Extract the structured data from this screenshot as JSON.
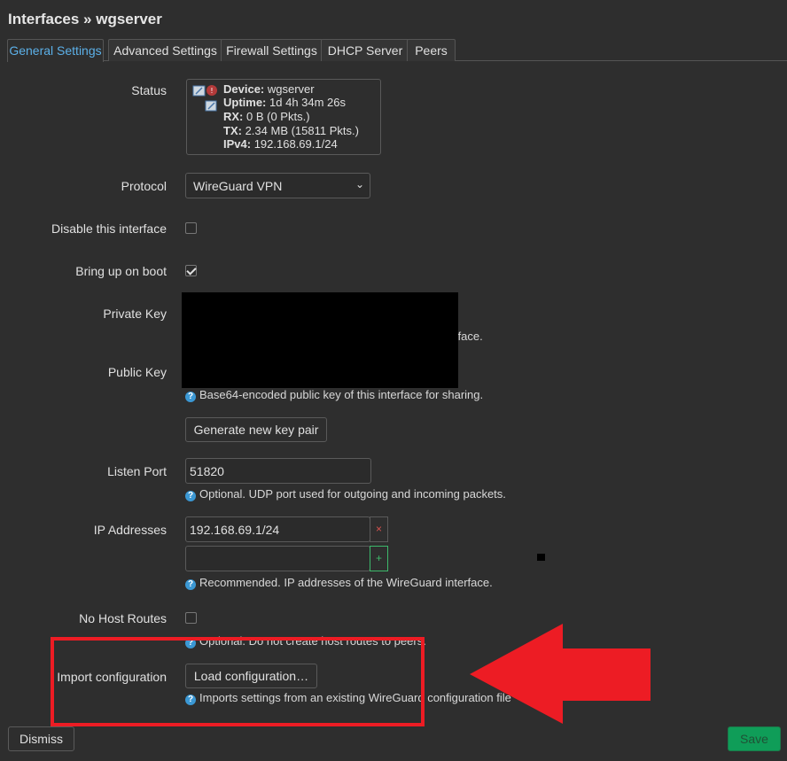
{
  "page_title": "Interfaces » wgserver",
  "tabs": [
    {
      "label": "General Settings"
    },
    {
      "label": "Advanced Settings"
    },
    {
      "label": "Firewall Settings"
    },
    {
      "label": "DHCP Server"
    },
    {
      "label": "Peers"
    }
  ],
  "status": {
    "label": "Status",
    "device_key": "Device:",
    "device_val": "wgserver",
    "uptime_key": "Uptime:",
    "uptime_val": "1d 4h 34m 26s",
    "rx_key": "RX:",
    "rx_val": "0 B (0 Pkts.)",
    "tx_key": "TX:",
    "tx_val": "2.34 MB (15811 Pkts.)",
    "ipv4_key": "IPv4:",
    "ipv4_val": "192.168.69.1/24"
  },
  "protocol": {
    "label": "Protocol",
    "value": "WireGuard VPN"
  },
  "disable_interface": {
    "label": "Disable this interface",
    "checked": false
  },
  "bring_up_on_boot": {
    "label": "Bring up on boot",
    "checked": true
  },
  "private_key": {
    "label": "Private Key",
    "hint_fragment": "erface."
  },
  "public_key": {
    "label": "Public Key",
    "hint": "Base64-encoded public key of this interface for sharing."
  },
  "generate_key_button": "Generate new key pair",
  "listen_port": {
    "label": "Listen Port",
    "value": "51820",
    "hint": "Optional. UDP port used for outgoing and incoming packets."
  },
  "ip_addresses": {
    "label": "IP Addresses",
    "values": [
      "192.168.69.1/24",
      ""
    ],
    "remove_glyph": "×",
    "add_glyph": "+",
    "hint": "Recommended. IP addresses of the WireGuard interface."
  },
  "no_host_routes": {
    "label": "No Host Routes",
    "checked": false,
    "hint": "Optional. Do not create host routes to peers."
  },
  "import_configuration": {
    "label": "Import configuration",
    "button": "Load configuration…",
    "hint": "Imports settings from an existing WireGuard configuration file"
  },
  "footer": {
    "dismiss": "Dismiss",
    "save": "Save"
  },
  "colors": {
    "accent": "#5cb0e8",
    "annotation_red": "#ed1c24",
    "save_green": "#0f9d58"
  }
}
